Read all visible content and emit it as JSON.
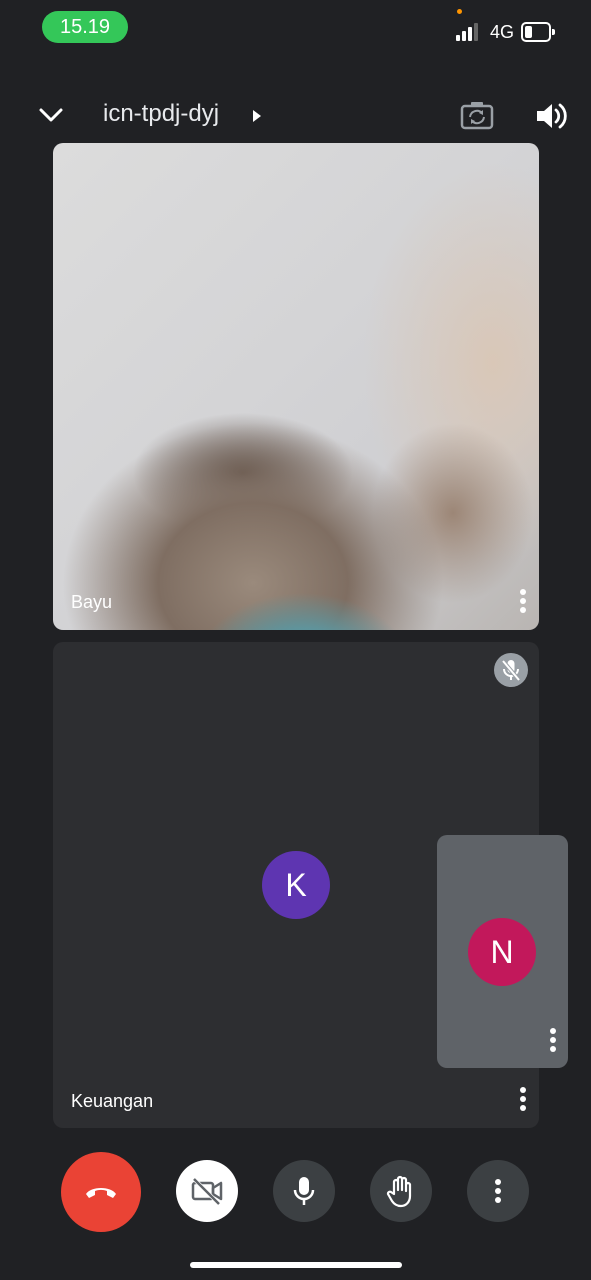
{
  "status_bar": {
    "time": "15.19",
    "network": "4G",
    "battery_level": 0.2,
    "signal_bars": 3
  },
  "header": {
    "meeting_code": "icn-tpdj-dyj"
  },
  "participants": [
    {
      "name": "Bayu",
      "type": "video"
    },
    {
      "name": "Keuangan",
      "avatar_letter": "K",
      "avatar_color": "#5e35b1",
      "muted": true
    }
  ],
  "self_view": {
    "avatar_letter": "N",
    "avatar_color": "#c2185b"
  },
  "controls": {
    "end_call_color": "#ea4335",
    "icons": [
      "end-call-icon",
      "camera-off-icon",
      "microphone-icon",
      "raise-hand-icon",
      "more-options-icon"
    ]
  },
  "colors": {
    "background": "#202124",
    "tile": "#2d2e31",
    "self_tile": "#5f6368",
    "status_pill": "#34c759"
  }
}
